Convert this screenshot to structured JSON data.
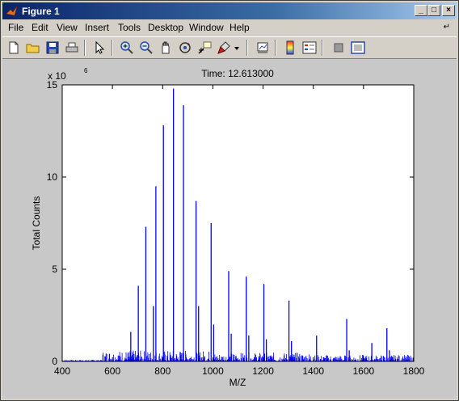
{
  "window": {
    "title": "Figure 1",
    "controls": {
      "minimize": "_",
      "maximize": "□",
      "close": "×"
    }
  },
  "menu": {
    "items": [
      "File",
      "Edit",
      "View",
      "Insert",
      "Tools",
      "Desktop",
      "Window",
      "Help"
    ],
    "overflow_icon": "dock-arrow-icon"
  },
  "toolbar": {
    "buttons": [
      "new-figure-icon",
      "open-file-icon",
      "save-icon",
      "print-icon",
      "pointer-icon",
      "zoom-in-icon",
      "zoom-out-icon",
      "pan-hand-icon",
      "rotate-3d-icon",
      "data-cursor-icon",
      "brush-icon",
      "link-plot-icon",
      "colorbar-icon",
      "legend-icon",
      "hide-plot-tools-icon",
      "show-plot-tools-icon"
    ]
  },
  "chart_data": {
    "type": "bar",
    "title": "Time: 12.613000",
    "xlabel": "M/Z",
    "ylabel": "Total Counts",
    "y_exponent_label": "x 10",
    "y_exponent": "6",
    "xlim": [
      400,
      1800
    ],
    "ylim": [
      0,
      15
    ],
    "x_ticks": [
      "400",
      "600",
      "800",
      "1000",
      "1200",
      "1400",
      "1600",
      "1800"
    ],
    "y_ticks": [
      "0",
      "5",
      "10",
      "15"
    ],
    "series_color": "#0000ff",
    "grid": false,
    "peaks": {
      "x": [
        673,
        703,
        733,
        763,
        773,
        803,
        843,
        883,
        933,
        943,
        993,
        1003,
        1063,
        1073,
        1133,
        1143,
        1203,
        1213,
        1303,
        1313,
        1413,
        1533,
        1543,
        1633,
        1693,
        1703
      ],
      "y": [
        1.6,
        4.1,
        7.3,
        3.0,
        9.5,
        12.8,
        14.8,
        13.9,
        8.7,
        3.0,
        7.5,
        2.0,
        4.9,
        1.5,
        4.6,
        1.4,
        4.2,
        1.2,
        3.3,
        1.1,
        1.4,
        2.3,
        0.6,
        1.0,
        1.8,
        0.6
      ]
    },
    "noise_region": [
      560,
      1800
    ],
    "noise_max": 0.6
  }
}
